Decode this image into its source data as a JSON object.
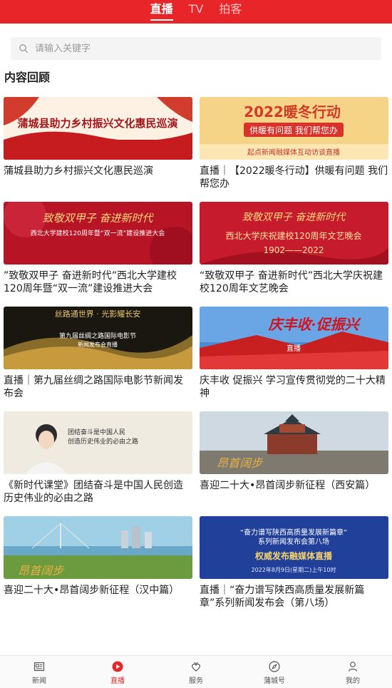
{
  "header": {
    "tabs": [
      {
        "label": "直播",
        "active": true
      },
      {
        "label": "TV",
        "active": false
      },
      {
        "label": "拍客",
        "active": false
      }
    ]
  },
  "search": {
    "placeholder": "请输入关键字",
    "icon": "search-icon"
  },
  "section": {
    "title": "内容回顾"
  },
  "cards": [
    {
      "caption": "蒲城县助力乡村振兴文化惠民巡演",
      "thumb_text": "蒲城县助力乡村振兴文化惠民巡演",
      "thumb_sub": ""
    },
    {
      "caption": "直播｜【2022暖冬行动】供暖有问题 我们帮您办",
      "thumb_text": "2022暖冬行动",
      "thumb_sub": "供暖有问题  我们帮您办",
      "thumb_sub2": "起点新闻融媒体互动访谈直播"
    },
    {
      "caption": "”致敬双甲子 奋进新时代”西北大学建校120周年暨“双一流”建设推进大会",
      "thumb_text": "致敬双甲子  奋进新时代",
      "thumb_sub": "西北大学建校120周年暨“双一流”建设推进大会"
    },
    {
      "caption": "“致敬双甲子 奋进新时代”西北大学庆祝建校120周年文艺晚会",
      "thumb_text": "致敬双甲子  奋进新时代",
      "thumb_sub": "西北大学庆祝建校120周年文艺晚会",
      "thumb_sub2": "1902——2022"
    },
    {
      "caption": "直播｜第九届丝绸之路国际电影节新闻发布会",
      "thumb_text": "丝路通世界 · 光影耀长安",
      "thumb_sub": "第九届丝绸之路国际电影节",
      "thumb_sub2": "新闻发布会直播"
    },
    {
      "caption": "庆丰收 促振兴 学习宣传贯彻党的二十大精神",
      "thumb_text": "庆丰收·促振兴",
      "thumb_sub": "直播"
    },
    {
      "caption": "《新时代课堂》团结奋斗是中国人民创造历史伟业的必由之路",
      "thumb_text": "团结奋斗是中国人民",
      "thumb_sub": "创造历史伟业的必由之路"
    },
    {
      "caption": "喜迎二十大•昂首阔步新征程（西安篇）",
      "thumb_text": "昂首阔步",
      "thumb_sub": ""
    },
    {
      "caption": "喜迎二十大•昂首阔步新征程（汉中篇）",
      "thumb_text": "昂首阔步",
      "thumb_sub": ""
    },
    {
      "caption": "直播｜“奋力谱写陕西高质量发展新篇章”系列新闻发布会（第八场）",
      "thumb_text": "“奋力谱写陕西高质量发展新篇章”",
      "thumb_sub": "系列新闻发布会第八场",
      "thumb_sub2": "权威发布融媒体直播",
      "thumb_sub3": "2022年8月9日(星期二)上午10时"
    }
  ],
  "bottom_nav": [
    {
      "label": "新闻",
      "icon": "news-icon",
      "active": false
    },
    {
      "label": "直播",
      "icon": "play-icon",
      "active": true
    },
    {
      "label": "服务",
      "icon": "service-icon",
      "active": false
    },
    {
      "label": "蒲城号",
      "icon": "compass-icon",
      "active": false
    },
    {
      "label": "我的",
      "icon": "user-icon",
      "active": false
    }
  ],
  "colors": {
    "accent": "#e8262a"
  }
}
